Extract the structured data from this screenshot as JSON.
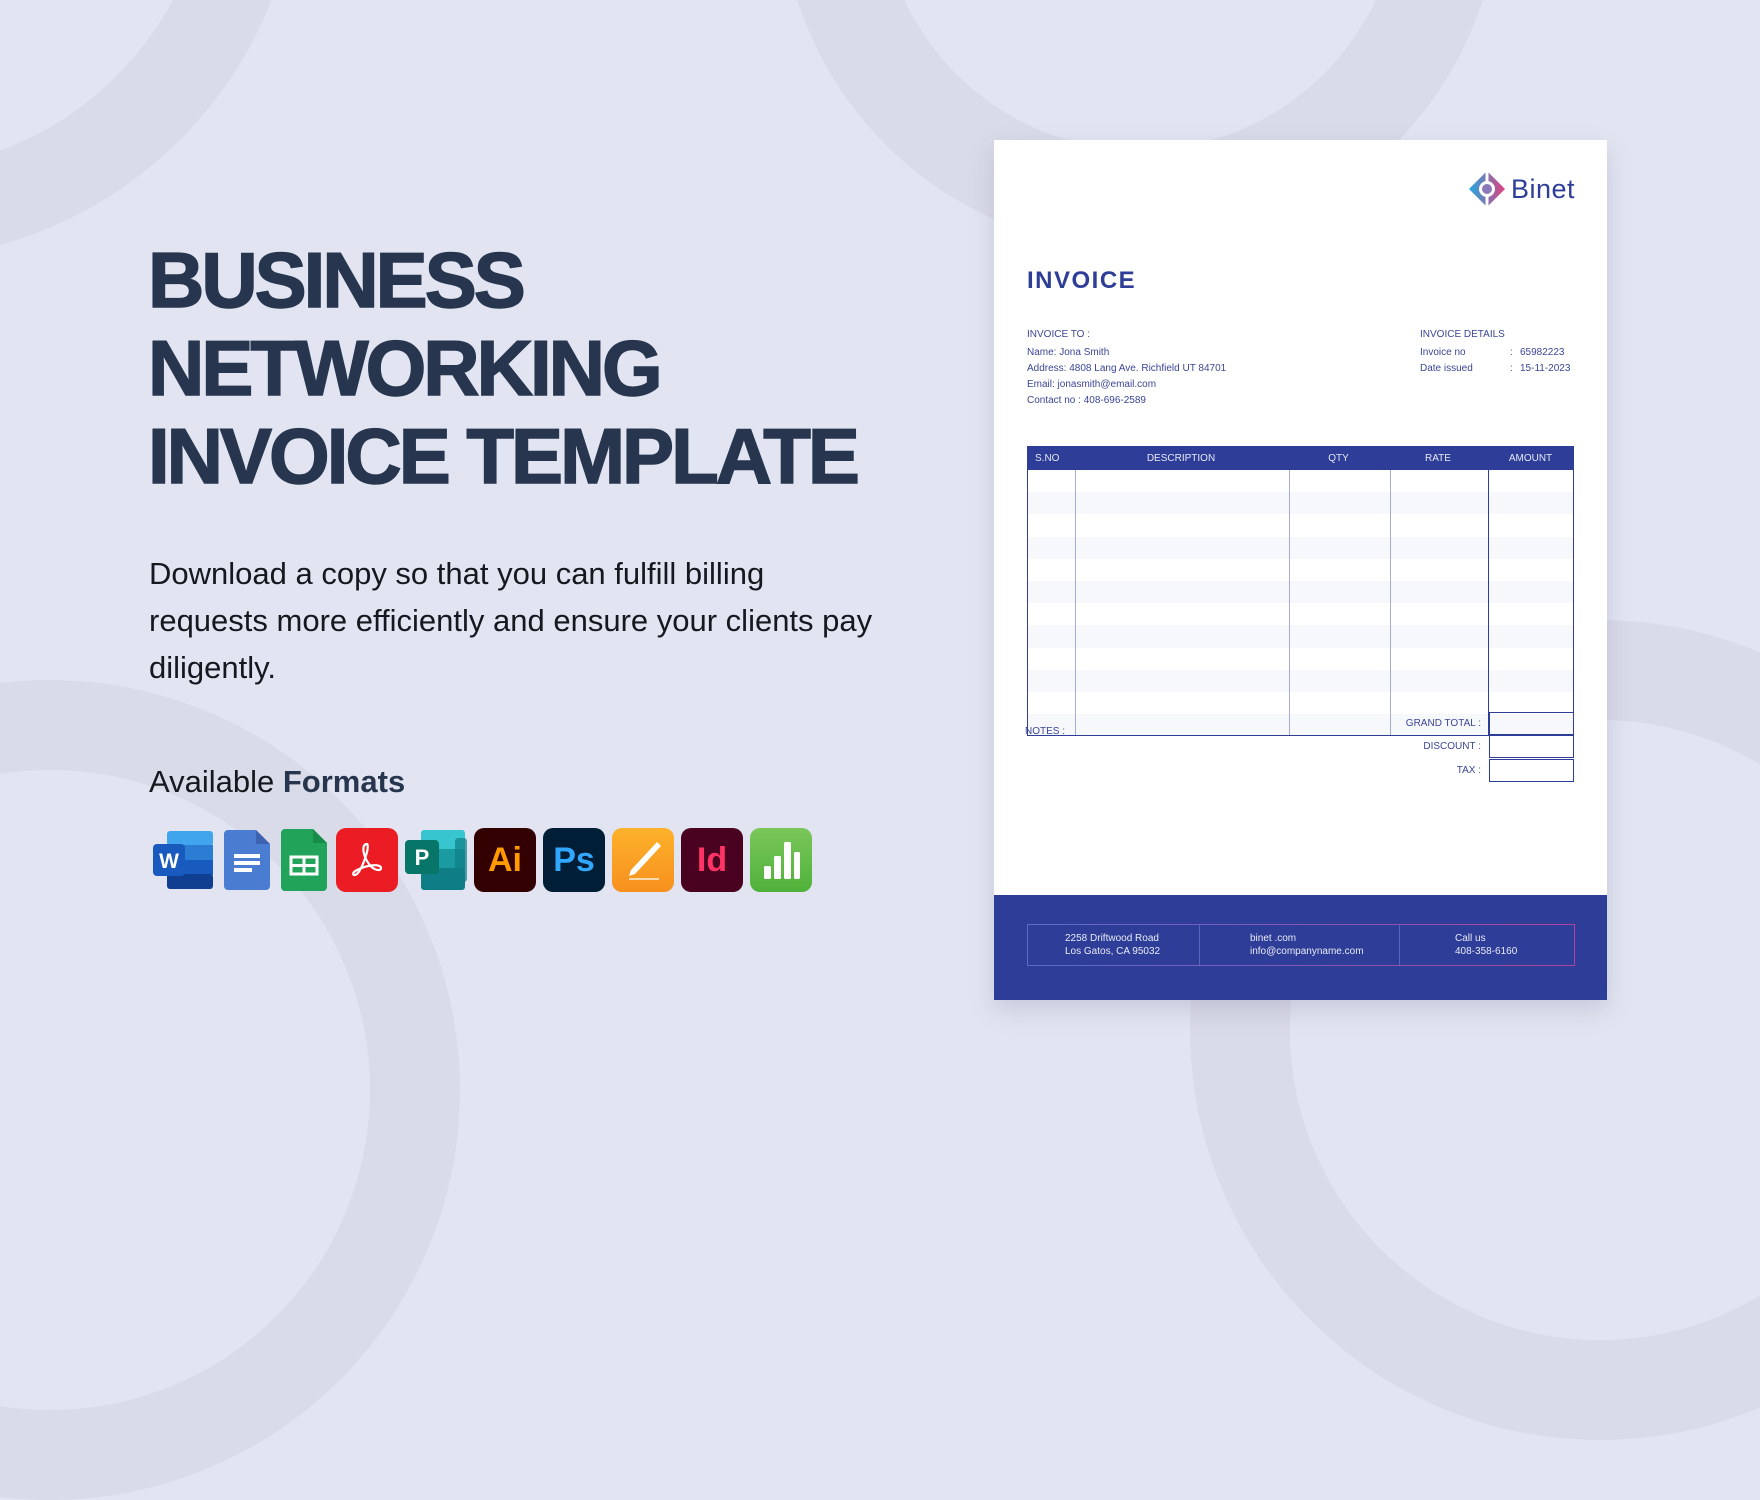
{
  "hero": {
    "title_lines": [
      "BUSINESS",
      "NETWORKING",
      "INVOICE TEMPLATE"
    ],
    "description": "Download a copy so that you can fulfill billing requests more efficiently and ensure your clients pay diligently.",
    "formats_label_prefix": "Available",
    "formats_label_bold": "Formats",
    "formats": [
      {
        "name": "Microsoft Word",
        "icon": "word-icon",
        "glyph": "W",
        "color": "#2B579A"
      },
      {
        "name": "Google Docs",
        "icon": "google-docs-icon",
        "glyph": "",
        "color": "#4A7CD1"
      },
      {
        "name": "Google Sheets",
        "icon": "google-sheets-icon",
        "glyph": "",
        "color": "#21A45A"
      },
      {
        "name": "Adobe PDF",
        "icon": "adobe-pdf-icon",
        "glyph": "",
        "color": "#EC1C24"
      },
      {
        "name": "Microsoft Publisher",
        "icon": "publisher-icon",
        "glyph": "P",
        "color": "#077568"
      },
      {
        "name": "Adobe Illustrator",
        "icon": "illustrator-icon",
        "glyph": "Ai",
        "color": "#330000"
      },
      {
        "name": "Adobe Photoshop",
        "icon": "photoshop-icon",
        "glyph": "Ps",
        "color": "#001E36"
      },
      {
        "name": "Apple Pages",
        "icon": "pages-icon",
        "glyph": "",
        "color": "#F7A21B"
      },
      {
        "name": "Adobe InDesign",
        "icon": "indesign-icon",
        "glyph": "Id",
        "color": "#49021F"
      },
      {
        "name": "Apple Numbers",
        "icon": "numbers-icon",
        "glyph": "",
        "color": "#5DBB46"
      }
    ]
  },
  "invoice": {
    "brand": "Binet",
    "title": "INVOICE",
    "accent_color": "#2E3D97",
    "bill_to": {
      "heading": "INVOICE TO :",
      "lines": [
        "Name: Jona Smith",
        "Address: 4808 Lang Ave. Richfield UT 84701",
        "Email: jonasmith@email.com",
        "Contact no : 408-696-2589"
      ]
    },
    "details": {
      "heading": "INVOICE DETAILS",
      "rows": [
        {
          "label": "Invoice no",
          "sep": ":",
          "value": "65982223"
        },
        {
          "label": "Date issued",
          "sep": ":",
          "value": "15-11-2023"
        }
      ]
    },
    "table": {
      "columns": [
        "S.NO",
        "DESCRIPTION",
        "QTY",
        "RATE",
        "AMOUNT"
      ],
      "rows": []
    },
    "notes_label": "NOTES :",
    "totals": [
      {
        "label": "GRAND TOTAL :",
        "value": ""
      },
      {
        "label": "DISCOUNT :",
        "value": ""
      },
      {
        "label": "TAX :",
        "value": ""
      }
    ],
    "footer": {
      "address": [
        "2258 Driftwood Road",
        "Los Gatos, CA 95032"
      ],
      "web": [
        "binet .com",
        "info@companyname.com"
      ],
      "phone": [
        "Call us",
        "408-358-6160"
      ]
    }
  }
}
